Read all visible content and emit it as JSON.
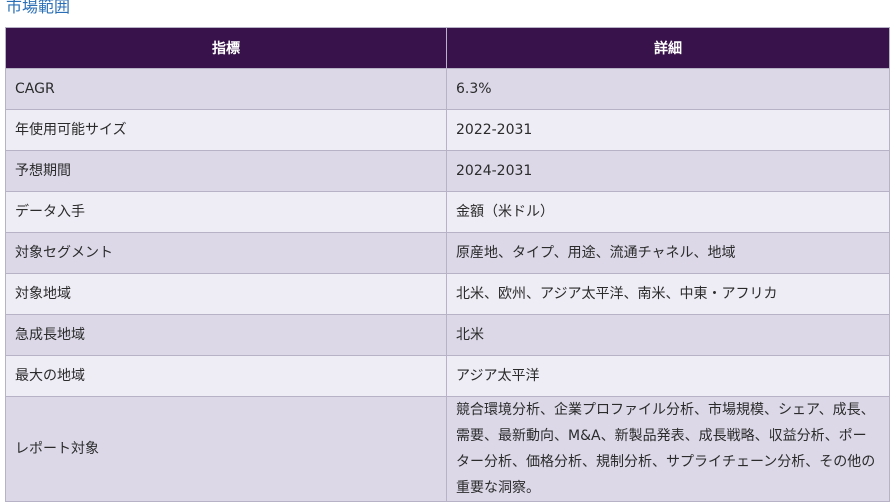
{
  "section_title": "市場範囲",
  "table": {
    "headers": [
      "指標",
      "詳細"
    ],
    "rows": [
      {
        "metric": "CAGR",
        "detail": "6.3%"
      },
      {
        "metric": "年使用可能サイズ",
        "detail": "2022-2031"
      },
      {
        "metric": "予想期間",
        "detail": "2024-2031"
      },
      {
        "metric": "データ入手",
        "detail": "金額（米ドル）"
      },
      {
        "metric": "対象セグメント",
        "detail": "原産地、タイプ、用途、流通チャネル、地域"
      },
      {
        "metric": "対象地域",
        "detail": "北米、欧州、アジア太平洋、南米、中東・アフリカ"
      },
      {
        "metric": "急成長地域",
        "detail": "北米"
      },
      {
        "metric": "最大の地域",
        "detail": "アジア太平洋"
      },
      {
        "metric": "レポート対象",
        "detail": "競合環境分析、企業プロファイル分析、市場規模、シェア、成長、需要、最新動向、M&A、新製品発表、成長戦略、収益分析、ポーター分析、価格分析、規制分析、サプライチェーン分析、その他の重要な洞察。"
      }
    ]
  }
}
